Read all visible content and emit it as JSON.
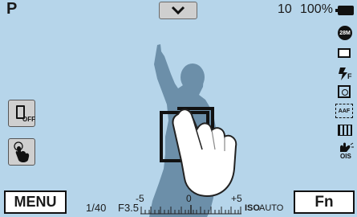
{
  "header": {
    "mode": "P",
    "shots_remaining": "10",
    "battery": "100%"
  },
  "icons": {
    "image_size": "28M",
    "flash_mode_suffix": "F",
    "af_label": "AAF",
    "stabilizer_label": "OIS"
  },
  "sidebar": {
    "self_timer_label": "OFF"
  },
  "footer": {
    "menu_label": "MENU",
    "fn_label": "Fn",
    "shutter": "1/40",
    "aperture": "F3.5",
    "ev_scale": [
      "-5",
      "0",
      "+5"
    ],
    "iso_label": "ISO",
    "iso_value": "AUTO"
  }
}
